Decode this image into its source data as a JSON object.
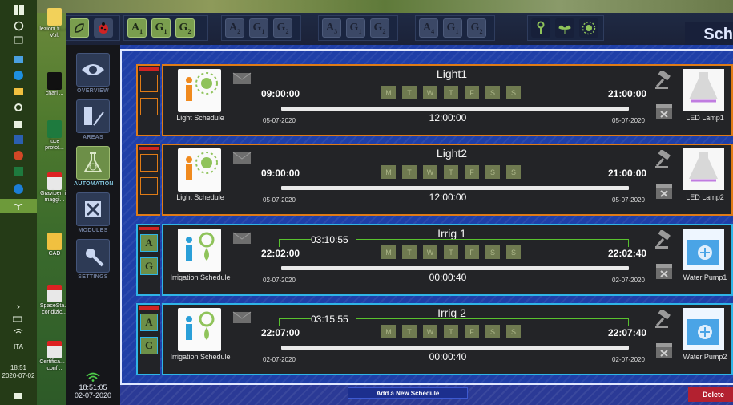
{
  "taskbar": {
    "time": "18:51",
    "date": "2020-07-02",
    "lang": "ITA"
  },
  "desktop_icons": [
    {
      "label": "lezioni fi... A Volt"
    },
    {
      "label": "charli..."
    },
    {
      "label": "luce protot..."
    },
    {
      "label": "Gravipen in maggi..."
    },
    {
      "label": "CAD"
    },
    {
      "label": "SpaceSta... condizio..."
    },
    {
      "label": "Certifica... a conf..."
    }
  ],
  "toolbar": {
    "brand": "Sch"
  },
  "nav": {
    "items": [
      {
        "label": "OVERVIEW",
        "icon": "eye-icon",
        "active": false
      },
      {
        "label": "AREAS",
        "icon": "areas-icon",
        "active": false
      },
      {
        "label": "AUTOMATION",
        "icon": "flask-icon",
        "active": true
      },
      {
        "label": "MODULES",
        "icon": "modules-icon",
        "active": false
      },
      {
        "label": "SETTINGS",
        "icon": "settings-icon",
        "active": false
      }
    ],
    "clock_time": "18:51:05",
    "clock_date": "02-07-2020"
  },
  "schedules": [
    {
      "title": "Light1",
      "type_label": "Light Schedule",
      "start_time": "09:00:00",
      "end_time": "21:00:00",
      "start_date": "05-07-2020",
      "end_date": "05-07-2020",
      "duration": "12:00:00",
      "offset": "",
      "days": [
        "M",
        "T",
        "W",
        "T",
        "F",
        "S",
        "S"
      ],
      "device_label": "LED Lamp1",
      "kind": "light"
    },
    {
      "title": "Light2",
      "type_label": "Light Schedule",
      "start_time": "09:00:00",
      "end_time": "21:00:00",
      "start_date": "05-07-2020",
      "end_date": "05-07-2020",
      "duration": "12:00:00",
      "offset": "",
      "days": [
        "M",
        "T",
        "W",
        "T",
        "F",
        "S",
        "S"
      ],
      "device_label": "LED Lamp2",
      "kind": "light"
    },
    {
      "title": "Irrig 1",
      "type_label": "Irrigation Schedule",
      "start_time": "22:02:00",
      "end_time": "22:02:40",
      "start_date": "02-07-2020",
      "end_date": "02-07-2020",
      "duration": "00:00:40",
      "offset": "03:10:55",
      "days": [
        "M",
        "T",
        "W",
        "T",
        "F",
        "S",
        "S"
      ],
      "device_label": "Water Pump1",
      "kind": "irrigation"
    },
    {
      "title": "Irrig 2",
      "type_label": "Irrigation Schedule",
      "start_time": "22:07:00",
      "end_time": "22:07:40",
      "start_date": "02-07-2020",
      "end_date": "02-07-2020",
      "duration": "00:00:40",
      "offset": "03:15:55",
      "days": [
        "M",
        "T",
        "W",
        "T",
        "F",
        "S",
        "S"
      ],
      "device_label": "Water Pump2",
      "kind": "irrigation"
    }
  ],
  "bottom": {
    "add_label": "Add a New Schedule",
    "delete_label": "Delete"
  }
}
